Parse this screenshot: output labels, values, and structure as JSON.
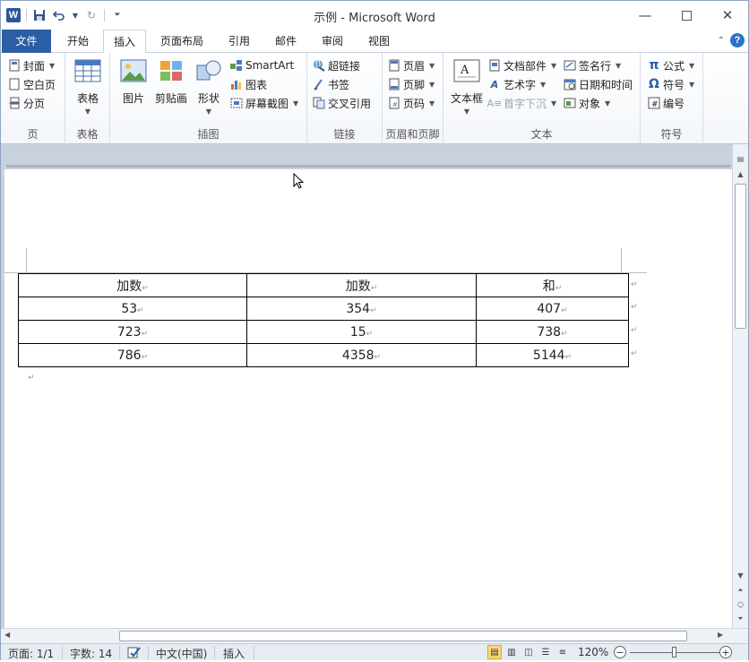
{
  "window": {
    "title": "示例 - Microsoft Word",
    "app_logo": "W",
    "controls": [
      "minimize-icon",
      "maximize-icon",
      "close-icon"
    ]
  },
  "tabs": [
    {
      "label": "文件"
    },
    {
      "label": "开始"
    },
    {
      "label": "插入",
      "active": true
    },
    {
      "label": "页面布局"
    },
    {
      "label": "引用"
    },
    {
      "label": "邮件"
    },
    {
      "label": "审阅"
    },
    {
      "label": "视图"
    }
  ],
  "ribbon": {
    "pages": {
      "label": "页",
      "items": [
        "封面",
        "空白页",
        "分页"
      ]
    },
    "tables": {
      "label": "表格",
      "table_button": "表格"
    },
    "illustrations": {
      "label": "插图",
      "picture": "图片",
      "clipart": "剪贴画",
      "shapes": "形状",
      "smartart": "SmartArt",
      "chart": "图表",
      "screenshot": "屏幕截图"
    },
    "links": {
      "label": "链接",
      "items": [
        "超链接",
        "书签",
        "交叉引用"
      ]
    },
    "header_footer": {
      "label": "页眉和页脚",
      "items": [
        "页眉",
        "页脚",
        "页码"
      ]
    },
    "text": {
      "label": "文本",
      "textbox": "文本框",
      "items": [
        "文档部件",
        "艺术字",
        "首字下沉",
        "签名行",
        "日期和时间",
        "对象"
      ]
    },
    "symbols": {
      "label": "符号",
      "items": [
        "公式",
        "符号",
        "编号"
      ]
    }
  },
  "document": {
    "table": {
      "header": [
        "加数",
        "加数",
        "和"
      ],
      "rows": [
        [
          "53",
          "354",
          "407"
        ],
        [
          "723",
          "15",
          "738"
        ],
        [
          "786",
          "4358",
          "5144"
        ]
      ]
    },
    "para_mark": "↵"
  },
  "statusbar": {
    "page": "页面: 1/1",
    "words": "字数: 14",
    "language": "中文(中国)",
    "mode": "插入",
    "zoom": "120%",
    "zoom_percent": 120
  },
  "colors": {
    "file_tab": "#2b5ea4",
    "accent": "#2b579a"
  }
}
